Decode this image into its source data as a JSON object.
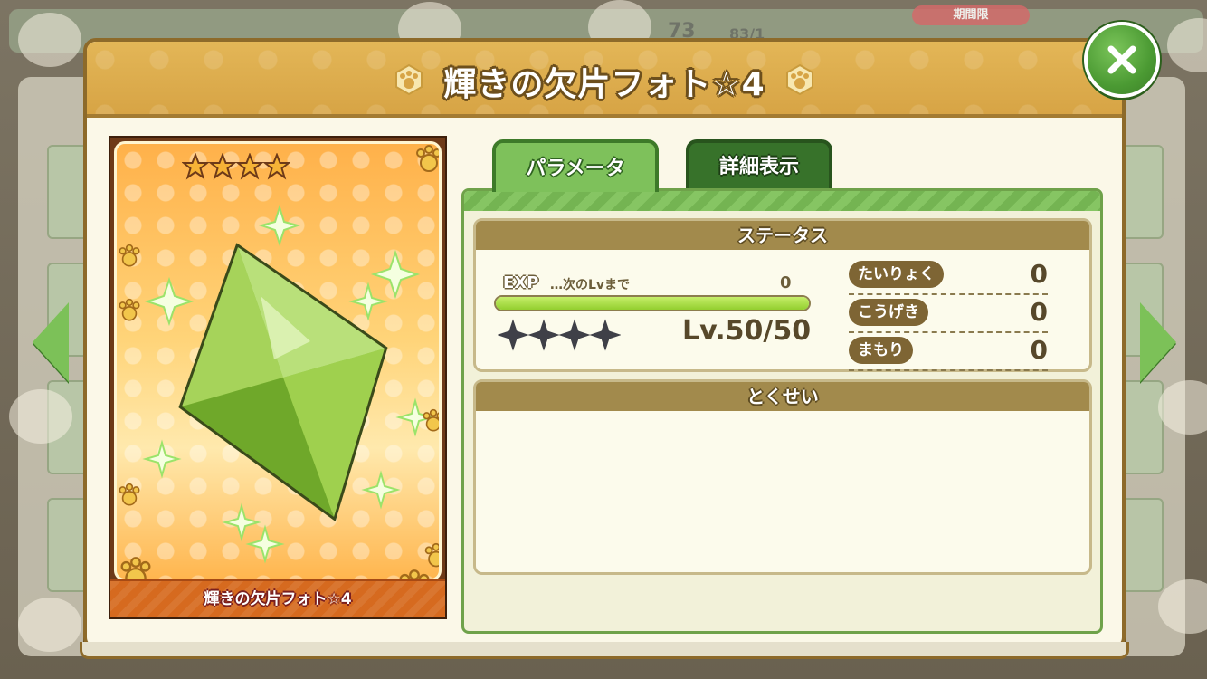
{
  "background": {
    "limited_badge": "期間限",
    "top_numbers": [
      "73",
      "83/1"
    ]
  },
  "modal": {
    "title": "輝きの欠片フォト☆4",
    "close_icon": "close-icon"
  },
  "card": {
    "rarity_stars": 4,
    "name": "輝きの欠片フォト☆4",
    "image": "green-crystal-shard"
  },
  "tabs": [
    {
      "label": "パラメータ",
      "active": true
    },
    {
      "label": "詳細表示",
      "active": false
    }
  ],
  "status": {
    "header": "ステータス",
    "exp_label": "EXP",
    "exp_note": "…次のLvまで",
    "exp_value": "0",
    "exp_progress": 1.0,
    "level_text": "Lv.50/50",
    "level_stars": 4,
    "stats": [
      {
        "label": "たいりょく",
        "value": "0"
      },
      {
        "label": "こうげき",
        "value": "0"
      },
      {
        "label": "まもり",
        "value": "0"
      }
    ]
  },
  "ability": {
    "header": "とくせい"
  },
  "colors": {
    "accent_green": "#7ec15b",
    "header_gold": "#d7a445",
    "section_brown": "#a28a4c"
  }
}
